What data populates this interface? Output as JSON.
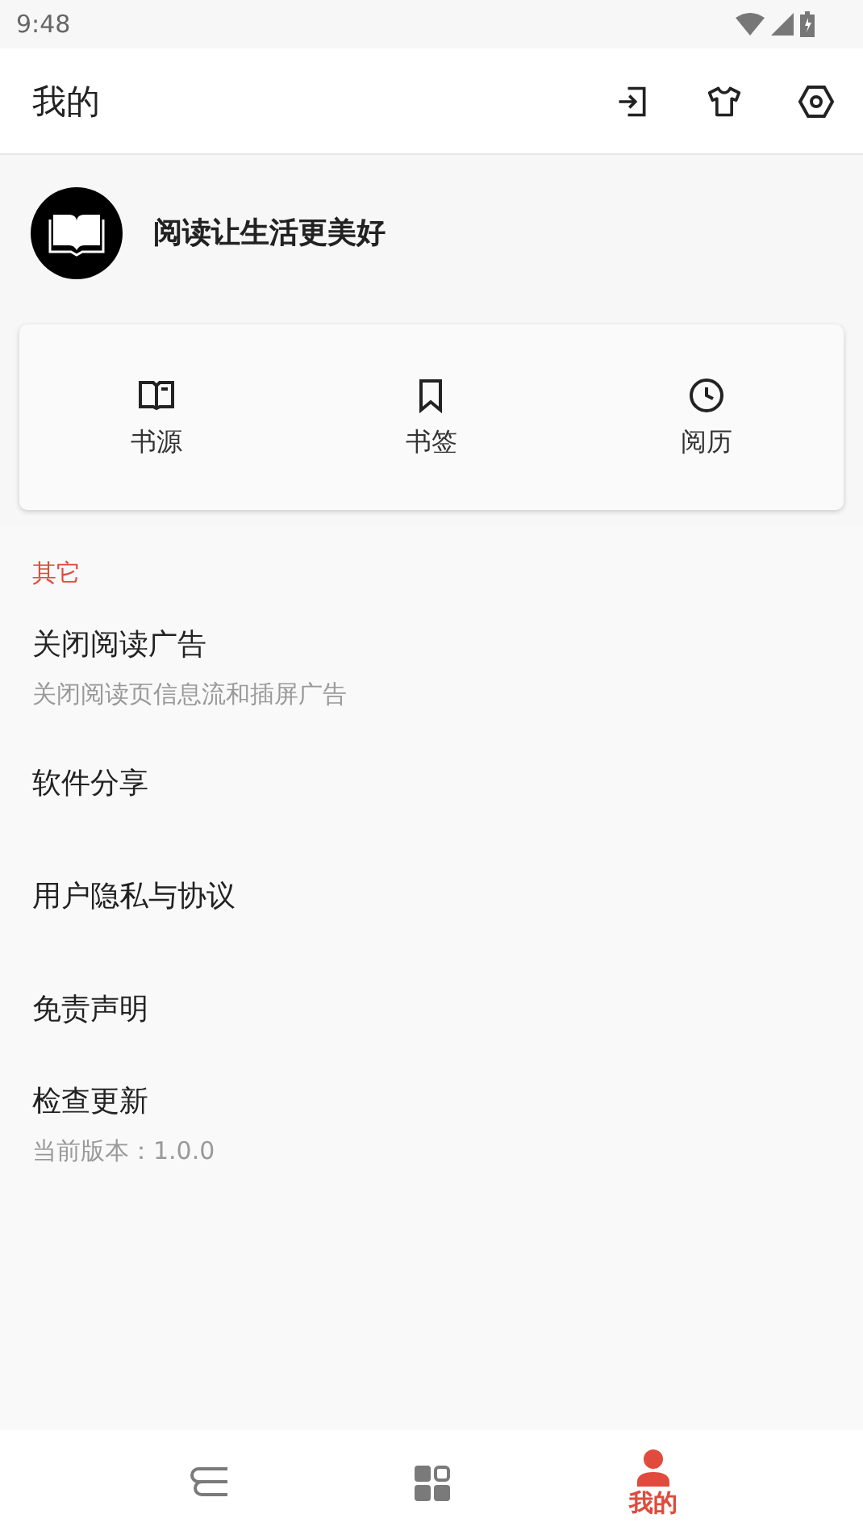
{
  "status_bar": {
    "time": "9:48"
  },
  "app_bar": {
    "title": "我的",
    "actions": [
      {
        "kind": "import"
      },
      {
        "kind": "theme"
      },
      {
        "kind": "settings"
      }
    ]
  },
  "profile": {
    "motto": "阅读让生活更美好"
  },
  "shortcuts": [
    {
      "kind": "book",
      "label": "书源"
    },
    {
      "kind": "bookmark",
      "label": "书签"
    },
    {
      "kind": "history",
      "label": "阅历"
    }
  ],
  "section": {
    "title": "其它",
    "items": [
      {
        "title": "关闭阅读广告",
        "subtitle": "关闭阅读页信息流和插屏广告"
      },
      {
        "title": "软件分享"
      },
      {
        "title": "用户隐私与协议"
      },
      {
        "title": "免责声明"
      },
      {
        "title": "检查更新",
        "subtitle": "当前版本：1.0.0"
      }
    ]
  },
  "bottom_nav": [
    {
      "kind": "shelf",
      "selected": false
    },
    {
      "kind": "discover",
      "selected": false
    },
    {
      "kind": "profile",
      "selected": true,
      "label": "我的"
    }
  ]
}
